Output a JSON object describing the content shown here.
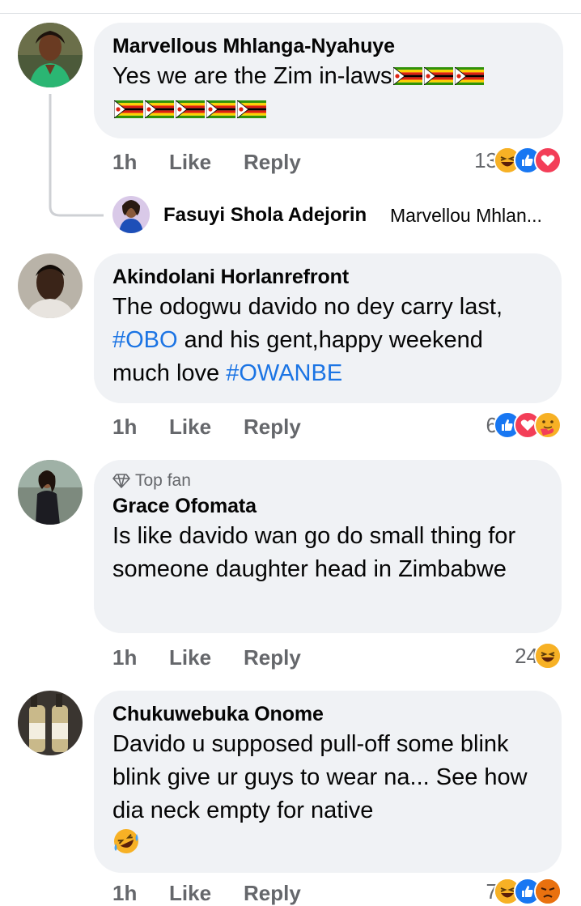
{
  "comments": [
    {
      "name": "Marvellous Mhlanga-Nyahuye",
      "text": "Yes we are the Zim in-laws",
      "time": "1h",
      "like": "Like",
      "reply": "Reply",
      "reaction_count": "13",
      "reactions": [
        "haha-icon",
        "like-icon",
        "love-icon"
      ],
      "flags_line1": 3,
      "flags_line2": 5
    },
    {
      "name": "Akindolani Horlanrefront",
      "text_parts": [
        "The odogwu davido no dey carry last, ",
        "#OBO",
        " and his gent,happy weekend much love ",
        "#OWANBE"
      ],
      "time": "1h",
      "like": "Like",
      "reply": "Reply",
      "reaction_count": "6",
      "reactions": [
        "like-icon",
        "love-icon",
        "care-icon"
      ]
    },
    {
      "badge": "Top fan",
      "name": "Grace Ofomata",
      "text": "Is like davido wan go do small thing for someone daughter head in Zimbabwe",
      "time": "1h",
      "like": "Like",
      "reply": "Reply",
      "reaction_count": "24",
      "reactions": [
        "haha-icon"
      ]
    },
    {
      "name": "Chukuwebuka Onome",
      "text": "Davido u supposed pull-off some blink blink give ur guys to wear na... See how dia neck empty for native",
      "time": "1h",
      "like": "Like",
      "reply": "Reply",
      "reaction_count": "7",
      "reactions": [
        "haha-icon",
        "like-icon",
        "angry-icon"
      ]
    }
  ],
  "reply_preview": {
    "name": "Fasuyi Shola Adejorin",
    "snippet": "Marvellou Mhlan..."
  },
  "colors": {
    "bubble": "#f0f2f5",
    "meta": "#65676b",
    "hashtag": "#1b74e4",
    "like_blue": "#1877f2",
    "love_red": "#f33e58",
    "haha_yellow": "#f7b125"
  }
}
